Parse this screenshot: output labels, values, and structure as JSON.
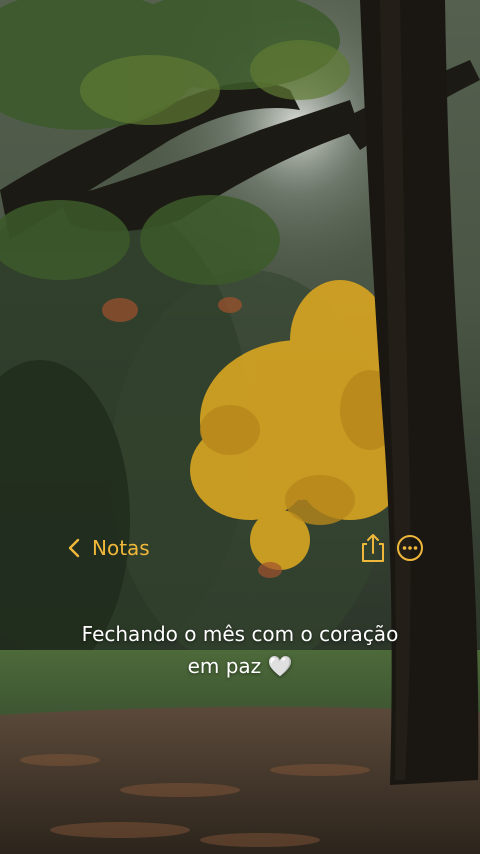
{
  "navigation": {
    "back_label": "Notas",
    "accent_color": "#f0b83a",
    "back_icon": "chevron-left-icon",
    "share_icon": "share-icon",
    "more_icon": "ellipsis-circle-icon"
  },
  "note": {
    "line1": "Fechando o mês com o coração",
    "line2": "em paz",
    "emoji": "🤍"
  },
  "background": {
    "description_icon": "autumn-tree-photo",
    "leaf_color": "#d9a521",
    "grass_color": "#3e5a2e"
  }
}
